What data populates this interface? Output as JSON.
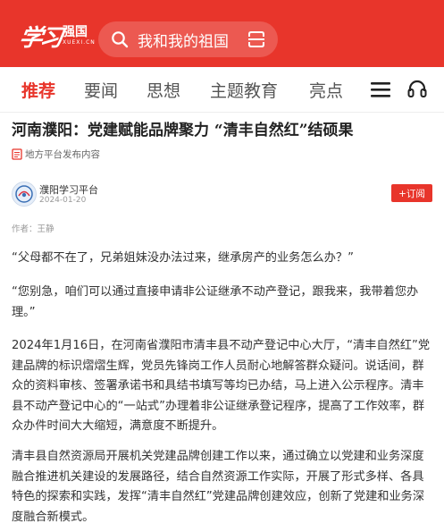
{
  "header": {
    "logo_mark": "学习",
    "logo_cn": "强国",
    "logo_en": "XUEXI.CN",
    "search_placeholder": "我和我的祖国"
  },
  "nav": {
    "tabs": [
      {
        "label": "推荐",
        "active": true
      },
      {
        "label": "要闻"
      },
      {
        "label": "思想"
      },
      {
        "label": "主题教育"
      },
      {
        "label": "亮点"
      }
    ]
  },
  "article": {
    "title": "河南濮阳：党建赋能品牌聚力 “清丰自然红”结硕果",
    "source_note": "地方平台发布内容",
    "account_name": "濮阳学习平台",
    "date": "2024-01-20",
    "subscribe_label": "+订阅",
    "author": "作者：王静",
    "paragraphs": [
      "“父母都不在了，兄弟姐妹没办法过来，继承房产的业务怎么办？”",
      "“您别急，咱们可以通过直接申请非公证继承不动产登记，跟我来，我带着您办理。”",
      "2024年1月16日，在河南省濮阳市清丰县不动产登记中心大厅，“清丰自然红”党建品牌的标识熠熠生辉，党员先锋岗工作人员耐心地解答群众疑问。说话间，群众的资料审核、签署承诺书和具结书填写等均已办结，马上进入公示程序。清丰县不动产登记中心的“一站式”办理着非公证继承登记程序，提高了工作效率，群众办件时间大大缩短，满意度不断提升。",
      "清丰县自然资源局开展机关党建品牌创建工作以来，通过确立以党建和业务深度融合推进机关建设的发展路径，结合自然资源工作实际，开展了形式多样、各具特色的探索和实践，发挥“清丰自然红”党建品牌创建效应，创新了党建和业务深度融合新模式。"
    ]
  },
  "colors": {
    "brand_red": "#e8352b"
  },
  "icons": [
    "search-icon",
    "scan-icon",
    "menu-icon",
    "headset-icon",
    "document-icon"
  ]
}
